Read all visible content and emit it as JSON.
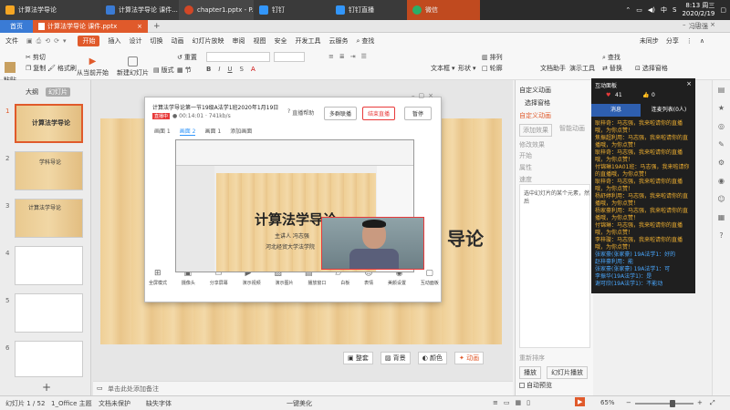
{
  "taskbar": {
    "tabs": [
      {
        "label": "计算法学导论",
        "color": "#f5a623"
      },
      {
        "label": "计算法学导论 课件...",
        "color": "#3a7bd5"
      },
      {
        "label": "chapter1.pptx - P...",
        "color": "#d24726"
      },
      {
        "label": "钉钉",
        "color": "#3296fa"
      },
      {
        "label": "钉钉直播",
        "color": "#3296fa"
      },
      {
        "label": "微信",
        "color": "#2aae67"
      }
    ],
    "lang": "中",
    "time": "8:13 周三",
    "date": "2020/2/19"
  },
  "wps": {
    "home_tab": "首页",
    "doc_tab": "计算法学导论 课件.pptx",
    "add": "+",
    "menus": [
      "文件",
      "开始",
      "插入",
      "设计",
      "切换",
      "动画",
      "幻灯片放映",
      "审阅",
      "视图",
      "安全",
      "开发工具",
      "云服务"
    ],
    "search": "查找",
    "user": "冯志强",
    "sync": "未同步",
    "share": "分享"
  },
  "ribbon": {
    "paste": "粘贴",
    "cut": "剪切",
    "copy": "复制",
    "format_painter": "格式刷",
    "from_current": "从当前开始",
    "new_slide": "新建幻灯片",
    "layout": "版式",
    "section": "节",
    "reset": "重置",
    "textbox": "文本框",
    "shape": "形状",
    "arrange": "排列",
    "outline": "轮廓",
    "doc_assist": "文档助手",
    "presenter": "演示工具",
    "replace": "替换",
    "select_pane": "选择窗格",
    "find": "查找"
  },
  "left_pane": {
    "tab_outline": "大纲",
    "tab_slides": "幻灯片",
    "numbers": [
      "1",
      "2",
      "3",
      "4",
      "5",
      "6"
    ],
    "thumb1_title": "计算法学导论",
    "thumb2_title": "学科导论",
    "thumb3_title": "计算法学导论",
    "add": "+"
  },
  "slide": {
    "title": "计算法学导论",
    "speaker": "主讲人  冯志强",
    "school": "河北经贸大学法学院"
  },
  "live": {
    "title": "计算法学导论第一节19级A法学1班2020年1月19日",
    "status": "直播中",
    "timer": "● 00:14:01 · 741kb/s",
    "help": "直播帮助",
    "multi": "多群联播",
    "end": "结束直播",
    "pause": "暂停",
    "tab1": "画面 1",
    "tab2": "画面 2",
    "tab3": "画面 1",
    "add_screen": "添加画面",
    "toolbar": [
      "全屏模式",
      "摄像头",
      "分享屏幕",
      "演示视频",
      "演示图片",
      "播放窗口",
      "白板",
      "表情",
      "美颜设置",
      "互动面板"
    ]
  },
  "anim_pane": {
    "header": "自定义动画",
    "select_pane": "选择窗格",
    "custom": "自定义动画",
    "add_effect": "添加效果",
    "smart": "智能动画",
    "modify": "修改效果",
    "start": "开始",
    "property": "属性",
    "speed": "速度",
    "hint": "选中幻灯片的某个元素，然后",
    "reorder": "重新排序",
    "play": "播放",
    "slideshow": "幻灯片播放",
    "auto_preview": "自动预览"
  },
  "chat": {
    "header": "互动面板",
    "likes": "41",
    "thumbs": "0",
    "tab_msg": "消息",
    "tab_viewers": "连麦列表(0人)",
    "lines": [
      {
        "text": "耿梓奇：马志强，我来啦请你的直播哦，为你点赞！",
        "blue": false
      },
      {
        "text": "焦振超利用：马志强，我来啦请你的直播哦，为你点赞！",
        "blue": false
      },
      {
        "text": "耿梓奇：马志强，我来啦请你的直播哦，为你点赞！",
        "blue": false
      },
      {
        "text": "付锦琳19A01班：马志强，我来啦请你的直播哦，为你点赞！",
        "blue": false
      },
      {
        "text": "耿梓奇：马志强，我来啦请你的直播哦，为你点赞！",
        "blue": false
      },
      {
        "text": "杨舒婷利用：马志强，我来啦请你的直播哦，为你点赞！",
        "blue": false
      },
      {
        "text": "杨家豪利用：马志强，我来啦请你的直播哦，为你点赞！",
        "blue": false
      },
      {
        "text": "付锦琳：马志强，我来啦请你的直播哦，为你点赞！",
        "blue": false
      },
      {
        "text": "李梓璇：马志强，我来啦请你的直播哦，为你点赞！",
        "blue": false
      },
      {
        "text": "张家豪(张家豪) 19A法学1：好的",
        "blue": true
      },
      {
        "text": "赵梓豪利用：能",
        "blue": true
      },
      {
        "text": "张家豪(张家豪) 19A法学1：可",
        "blue": true
      },
      {
        "text": "李振华(19A法学1)：是",
        "blue": true
      },
      {
        "text": "谢可欣(19A法学1)：不能动",
        "blue": true
      }
    ]
  },
  "status": {
    "slide": "幻灯片 1 / 52",
    "theme": "1_Office 主题",
    "protect": "文档未保护",
    "font": "缺失字体",
    "beautify": "一键美化",
    "notes": "单击此处添加备注",
    "zoom": "65%",
    "minus": "−",
    "plus": "+",
    "zoom_level": 0.65
  },
  "colors": {
    "accent": "#e05a2b",
    "chat_bg": "#1f1f1f",
    "chat_text": "#f0b030",
    "chat_blue": "#4aa8ff",
    "live_red": "#e83a3a"
  }
}
